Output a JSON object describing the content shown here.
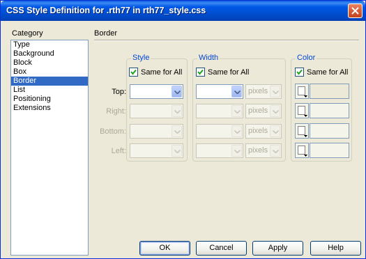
{
  "window": {
    "title": "CSS Style Definition for .rth77 in rth77_style.css"
  },
  "category": {
    "label": "Category",
    "items": [
      "Type",
      "Background",
      "Block",
      "Box",
      "Border",
      "List",
      "Positioning",
      "Extensions"
    ],
    "selected": "Border"
  },
  "section": {
    "title": "Border"
  },
  "groups": {
    "style": {
      "legend": "Style",
      "same_for_all": "Same for All",
      "checked": true
    },
    "width": {
      "legend": "Width",
      "same_for_all": "Same for All",
      "checked": true,
      "unit": "pixels"
    },
    "color": {
      "legend": "Color",
      "same_for_all": "Same for All",
      "checked": true
    }
  },
  "rows": {
    "top": "Top:",
    "right": "Right:",
    "bottom": "Bottom:",
    "left": "Left:"
  },
  "buttons": {
    "ok": "OK",
    "cancel": "Cancel",
    "apply": "Apply",
    "help": "Help"
  },
  "colors": {
    "title_bar": "#0054e3",
    "selection": "#316ac5",
    "legend": "#0046d5",
    "dialog_bg": "#ece9d8"
  }
}
